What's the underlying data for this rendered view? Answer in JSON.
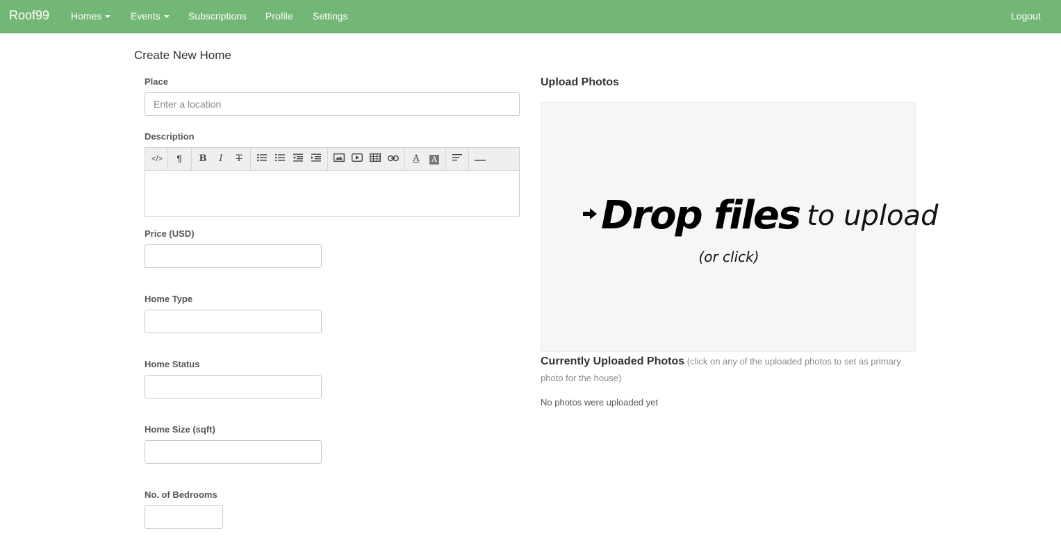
{
  "nav": {
    "brand": "Roof99",
    "items": [
      {
        "label": "Homes",
        "dropdown": true
      },
      {
        "label": "Events",
        "dropdown": true
      },
      {
        "label": "Subscriptions",
        "dropdown": false
      },
      {
        "label": "Profile",
        "dropdown": false
      },
      {
        "label": "Settings",
        "dropdown": false
      }
    ],
    "logout": "Logout",
    "bg_color": "#73b776"
  },
  "page": {
    "title": "Create New Home"
  },
  "form": {
    "place_label": "Place",
    "place_placeholder": "Enter a location",
    "place_value": "",
    "description_label": "Description",
    "description_toolbar": [
      "code-view-icon",
      "paragraph-icon",
      "bold-icon",
      "italic-icon",
      "strikethrough-icon",
      "unordered-list-icon",
      "ordered-list-icon",
      "outdent-icon",
      "indent-icon",
      "image-icon",
      "video-icon",
      "table-icon",
      "link-icon",
      "font-color-icon",
      "background-color-icon",
      "align-icon",
      "horizontal-rule-icon"
    ],
    "price_label": "Price (USD)",
    "home_type_label": "Home Type",
    "home_status_label": "Home Status",
    "home_size_label": "Home Size (sqft)",
    "bedrooms_label": "No. of Bedrooms"
  },
  "upload": {
    "title": "Upload Photos",
    "drop_strong": "Drop files",
    "drop_light": "to upload",
    "drop_or": "(or click)",
    "uploaded_title": "Currently Uploaded Photos",
    "uploaded_hint": "(click on any of the uploaded photos to set as primary photo for the house)",
    "no_photos": "No photos were uploaded yet"
  }
}
